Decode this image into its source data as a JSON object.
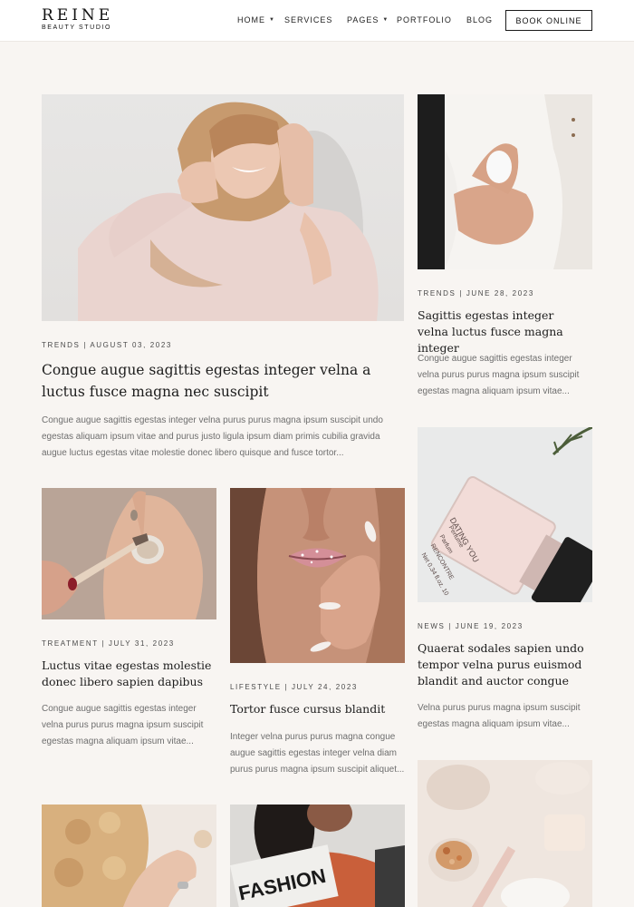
{
  "header": {
    "logo_main": "REINE",
    "logo_sub": "BEAUTY STUDIO",
    "nav": {
      "home": "HOME",
      "services": "SERVICES",
      "pages": "PAGES",
      "portfolio": "PORTFOLIO",
      "blog": "BLOG"
    },
    "book_button": "BOOK ONLINE"
  },
  "posts": [
    {
      "meta": "TRENDS | AUGUST 03, 2023",
      "title": "Congue augue sagittis egestas integer velna a luctus fusce magna nec suscipit",
      "excerpt": "Congue augue sagittis egestas integer velna purus purus magna ipsum suscipit undo egestas aliquam ipsum vitae and purus justo ligula ipsum diam primis cubilia gravida augue luctus egestas vitae molestie donec libero quisque and fusce tortor..."
    },
    {
      "meta": "TRENDS | JUNE 28, 2023",
      "title": "Sagittis egestas integer velna luctus fusce magna integer",
      "excerpt": "Congue augue sagittis egestas integer velna purus purus magna ipsum suscipit egestas magna aliquam ipsum vitae..."
    },
    {
      "meta": "TREATMENT | JULY 31, 2023",
      "title": "Luctus vitae egestas molestie donec libero sapien dapibus",
      "excerpt": "Congue augue sagittis egestas integer velna purus purus magna ipsum suscipit egestas magna aliquam ipsum vitae..."
    },
    {
      "meta": "LIFESTYLE | JULY 24, 2023",
      "title": "Tortor fusce cursus blandit",
      "excerpt": "Integer velna purus purus magna congue augue sagittis egestas integer velna diam purus purus magna ipsum suscipit aliquet..."
    },
    {
      "meta": "NEWS | JUNE 19, 2023",
      "title": "Quaerat sodales sapien undo tempor velna purus euismod blandit and auctor congue",
      "excerpt": "Velna purus purus magna ipsum suscipit egestas magna aliquam ipsum vitae..."
    }
  ],
  "image_text": {
    "perfume_label_1": "DATING YOU",
    "perfume_label_2": "Perfume",
    "perfume_label_3": "Parfum",
    "perfume_label_4": "RENCONTRE",
    "perfume_label_5": "Net 0.34 fl.oz. 10",
    "magazine_title": "FASHION"
  },
  "colors": {
    "background": "#f8f5f2",
    "header": "#ffffff",
    "text_dark": "#1c1c1c",
    "text_muted": "#6e6e6e"
  }
}
